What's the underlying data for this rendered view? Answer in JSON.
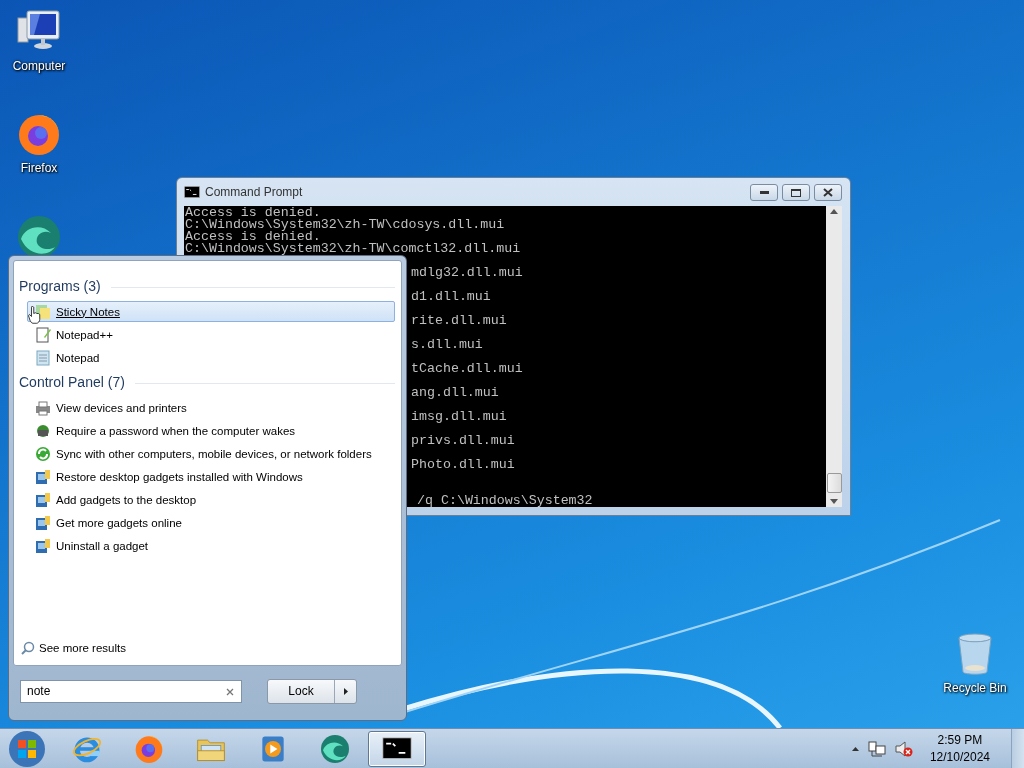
{
  "desktop_icons": [
    {
      "kind": "computer",
      "label": "Computer"
    },
    {
      "kind": "firefox",
      "label": "Firefox"
    },
    {
      "kind": "swirl"
    },
    {
      "kind": "recycle",
      "label": "Recycle Bin"
    }
  ],
  "command_prompt": {
    "title": "Command Prompt",
    "lines": [
      {
        "kind": "full",
        "text": "Access is denied."
      },
      {
        "kind": "full",
        "text": "C:\\Windows\\System32\\zh-TW\\cdosys.dll.mui"
      },
      {
        "kind": "full",
        "text": "Access is denied."
      },
      {
        "kind": "full",
        "text": "C:\\Windows\\System32\\zh-TW\\comctl32.dll.mui"
      },
      {
        "kind": "clipped",
        "text": "mdlg32.dll.mui"
      },
      {
        "kind": "clipped",
        "text": "d1.dll.mui"
      },
      {
        "kind": "clipped",
        "text": "rite.dll.mui"
      },
      {
        "kind": "clipped",
        "text": "s.dll.mui"
      },
      {
        "kind": "clipped",
        "text": "tCache.dll.mui"
      },
      {
        "kind": "clipped",
        "text": "ang.dll.mui"
      },
      {
        "kind": "clipped",
        "text": "imsg.dll.mui"
      },
      {
        "kind": "clipped",
        "text": "privs.dll.mui"
      },
      {
        "kind": "clipped",
        "text": "Photo.dll.mui"
      },
      {
        "kind": "prompt",
        "text": "/q C:\\Windows\\System32"
      }
    ]
  },
  "start_menu": {
    "groups": [
      {
        "heading": "Programs (3)",
        "items": [
          {
            "kind": "sticky",
            "label": "Sticky Notes",
            "selected": true
          },
          {
            "kind": "notepadpp",
            "label": "Notepad++",
            "selected": false
          },
          {
            "kind": "notepad",
            "label": "Notepad",
            "selected": false
          }
        ]
      },
      {
        "heading": "Control Panel (7)",
        "items": [
          {
            "kind": "printer",
            "label": "View devices and printers",
            "selected": false
          },
          {
            "kind": "password",
            "label": "Require a password when the computer wakes",
            "selected": false
          },
          {
            "kind": "sync",
            "label": "Sync with other computers, mobile devices, or network folders",
            "selected": false
          },
          {
            "kind": "gadget",
            "label": "Restore desktop gadgets installed with Windows",
            "selected": false
          },
          {
            "kind": "gadget",
            "label": "Add gadgets to the desktop",
            "selected": false
          },
          {
            "kind": "gadget",
            "label": "Get more gadgets online",
            "selected": false
          },
          {
            "kind": "gadget",
            "label": "Uninstall a gadget",
            "selected": false
          }
        ]
      }
    ],
    "see_more": "See more results",
    "search": {
      "value": "note"
    },
    "power_button": "Lock"
  },
  "taskbar": {
    "apps": [
      {
        "kind": "ie",
        "active": false
      },
      {
        "kind": "firefox",
        "active": false
      },
      {
        "kind": "folder",
        "active": false
      },
      {
        "kind": "media",
        "active": false
      },
      {
        "kind": "swirl",
        "active": false
      },
      {
        "kind": "cmd",
        "active": true
      }
    ],
    "clock": {
      "time": "2:59 PM",
      "date": "12/10/2024"
    }
  }
}
